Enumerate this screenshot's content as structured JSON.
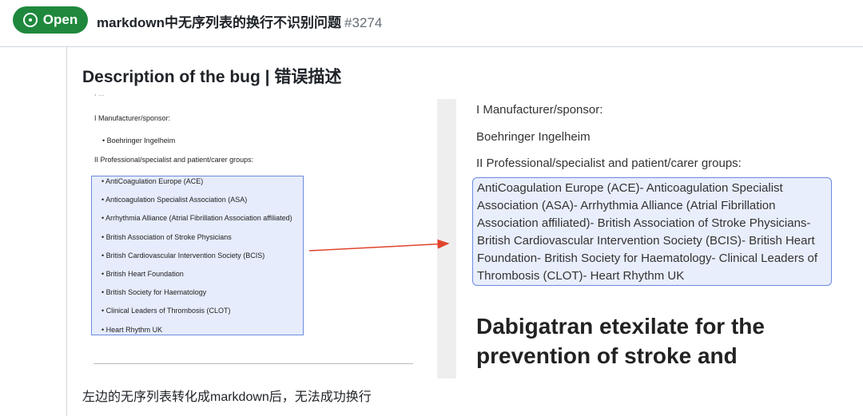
{
  "header": {
    "status_label": "Open",
    "title": "markdown中无序列表的换行不识别问题",
    "issue_number": "#3274",
    "status_color": "#1f883d"
  },
  "body": {
    "heading": "Description of the bug | 错误描述",
    "caption": "左边的无序列表转化成markdown后，无法成功换行"
  },
  "left_doc": {
    "section1": "I Manufacturer/sponsor:",
    "sponsor_item": "Boehringer Ingelheim",
    "section2": "II Professional/specialist and patient/carer groups:",
    "items": [
      "AntiCoagulation Europe (ACE)",
      "Anticoagulation Specialist Association (ASA)",
      "Arrhythmia Alliance (Atrial Fibrillation Association affiliated)",
      "British Association of Stroke Physicians",
      "British Cardiovascular Intervention Society (BCIS)",
      "British Heart Foundation",
      "British Society for Haematology",
      "Clinical Leaders of Thrombosis (CLOT)",
      "Heart Rhythm UK"
    ]
  },
  "right_doc": {
    "section1": "I Manufacturer/sponsor:",
    "sponsor_item": "Boehringer Ingelheim",
    "section2": "II Professional/specialist and patient/carer groups:",
    "merged_lines": [
      "AntiCoagulation Europe (ACE)- Anticoagulation Specialist",
      "Association (ASA)- Arrhythmia Alliance (Atrial Fibrillation",
      "Association affiliated)- British Association of Stroke Physicians-",
      "British Cardiovascular Intervention Society (BCIS)- British Heart",
      "Foundation- British Society for Haematology- Clinical Leaders of",
      "Thrombosis (CLOT)- Heart Rhythm UK"
    ],
    "title_line1": "Dabigatran etexilate for the",
    "title_line2": "prevention of stroke and"
  },
  "colors": {
    "highlight_border": "#6b8be0",
    "highlight_fill": "#e6ecfb",
    "arrow": "#e0442c"
  }
}
